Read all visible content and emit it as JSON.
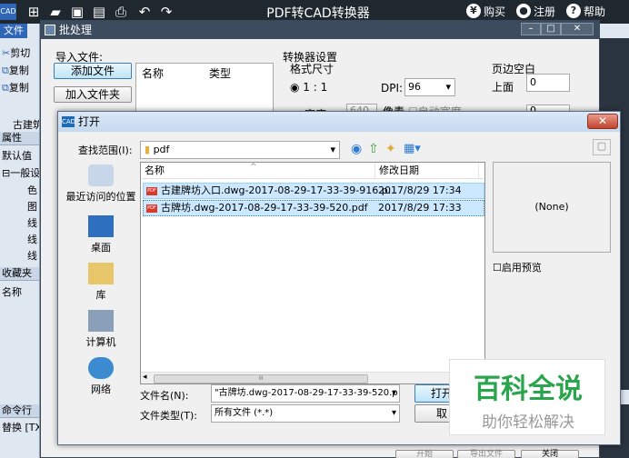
{
  "app": {
    "logo": "CAD",
    "title": "PDF转CAD转换器",
    "buy": "购买",
    "register": "注册",
    "help": "帮助"
  },
  "cad_panel": {
    "file_tab": "文件",
    "cut": "剪切",
    "copy1": "复制",
    "copy2": "复制",
    "drawing_name": "古建筑",
    "properties": "属性",
    "default": "默认值",
    "general": "一般设",
    "rows": [
      "色",
      "图",
      "线",
      "线",
      "线"
    ],
    "favorites": "收藏夹",
    "name": "名称",
    "command_line": "命令行",
    "replace": "替换 [TXT"
  },
  "batch": {
    "title": "批处理",
    "import_files": "导入文件:",
    "add_file": "添加文件",
    "add_folder": "加入文件夹",
    "col_name": "名称",
    "col_type": "类型",
    "converter_settings": "转换器设置",
    "format_size": "格式尺寸",
    "ratio": "1 : 1",
    "dpi_label": "DPI:",
    "dpi_value": "96",
    "width": "宽度",
    "width_value": "640",
    "pixel": "像素",
    "auto_width": "自动宽度",
    "margin": "页边空白",
    "top": "上面",
    "top_value": "0",
    "second_value": "0",
    "start": "开始",
    "export_file": "导出文件",
    "close": "关闭"
  },
  "open": {
    "title": "打开",
    "look_in_label": "查找范围(I):",
    "look_in_value": "pdf",
    "places": [
      "最近访问的位置",
      "桌面",
      "库",
      "计算机",
      "网络"
    ],
    "col_name": "名称",
    "col_modified": "修改日期",
    "files": [
      {
        "name": "古建牌坊入口.dwg-2017-08-29-17-33-39-916.p...",
        "date": "2017/8/29 17:34"
      },
      {
        "name": "古牌坊.dwg-2017-08-29-17-33-39-520.pdf",
        "date": "2017/8/29 17:33"
      }
    ],
    "preview_none": "(None)",
    "enable_preview": "启用预览",
    "filename_label": "文件名(N):",
    "filename_value": "\"古牌坊.dwg-2017-08-29-17-33-39-520.p",
    "filetype_label": "文件类型(T):",
    "filetype_value": "所有文件 (*.*)",
    "open_btn": "打开",
    "cancel_btn": "取"
  },
  "watermark": {
    "main": "百科全说",
    "sub": "助你轻松解决"
  },
  "colors": {
    "accent": "#2f66b8",
    "watermark_green": "#2aa44d"
  }
}
